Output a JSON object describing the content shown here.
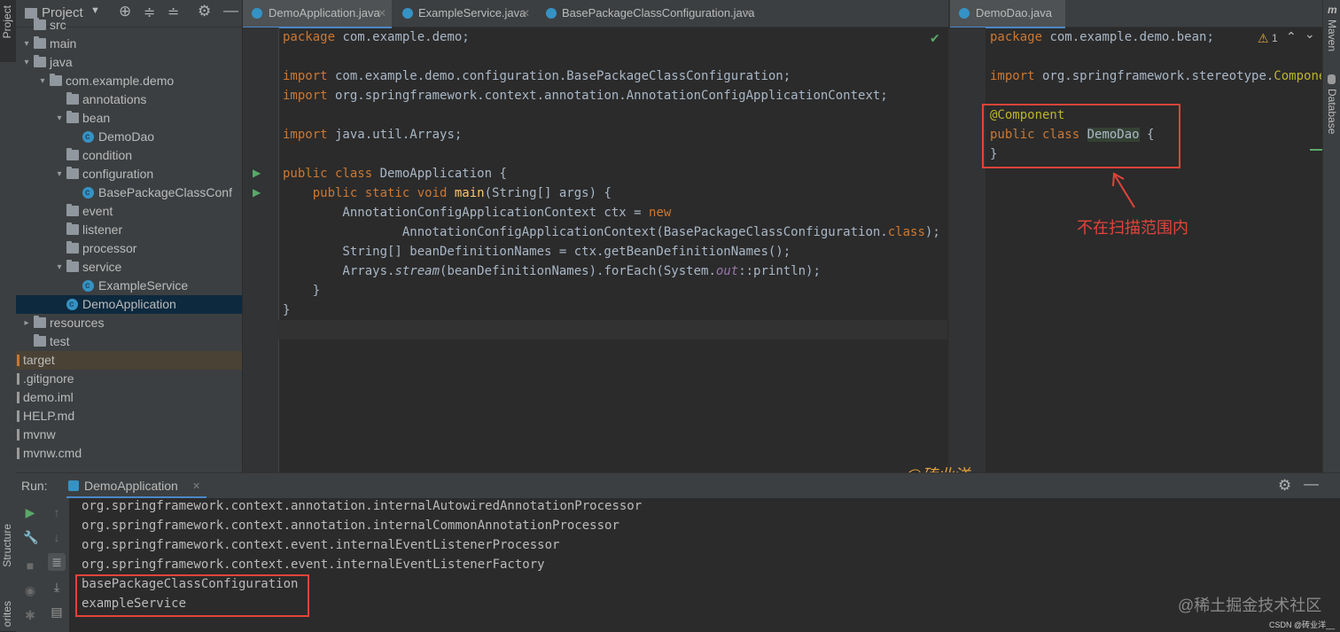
{
  "left_strip": {
    "project_label": "Project",
    "structure_label": "Structure",
    "favorites_label": "orites"
  },
  "right_strip": {
    "maven_label": "Maven",
    "database_label": "Database"
  },
  "project": {
    "title": "Project",
    "tree": [
      {
        "label": "src",
        "kind": "folder",
        "arrow": ""
      },
      {
        "label": "main",
        "kind": "folder",
        "arrow": "▾"
      },
      {
        "label": "java",
        "kind": "folder",
        "arrow": "▾"
      },
      {
        "label": "com.example.demo",
        "kind": "folder",
        "arrow": "▾"
      },
      {
        "label": "annotations",
        "kind": "folder",
        "arrow": ""
      },
      {
        "label": "bean",
        "kind": "folder",
        "arrow": "▾"
      },
      {
        "label": "DemoDao",
        "kind": "class",
        "arrow": ""
      },
      {
        "label": "condition",
        "kind": "folder",
        "arrow": ""
      },
      {
        "label": "configuration",
        "kind": "folder",
        "arrow": "▾"
      },
      {
        "label": "BasePackageClassConf",
        "kind": "class",
        "arrow": ""
      },
      {
        "label": "event",
        "kind": "folder",
        "arrow": ""
      },
      {
        "label": "listener",
        "kind": "folder",
        "arrow": ""
      },
      {
        "label": "processor",
        "kind": "folder",
        "arrow": ""
      },
      {
        "label": "service",
        "kind": "folder",
        "arrow": "▾"
      },
      {
        "label": "ExampleService",
        "kind": "class",
        "arrow": ""
      },
      {
        "label": "DemoApplication",
        "kind": "class",
        "arrow": "",
        "selected": true
      },
      {
        "label": "resources",
        "kind": "folder",
        "arrow": "▸"
      },
      {
        "label": "test",
        "kind": "folder",
        "arrow": ""
      },
      {
        "label": "target",
        "kind": "file",
        "arrow": ""
      },
      {
        "label": ".gitignore",
        "kind": "file",
        "arrow": ""
      },
      {
        "label": "demo.iml",
        "kind": "file",
        "arrow": ""
      },
      {
        "label": "HELP.md",
        "kind": "file",
        "arrow": ""
      },
      {
        "label": "mvnw",
        "kind": "file",
        "arrow": ""
      },
      {
        "label": "mvnw.cmd",
        "kind": "file",
        "arrow": ""
      }
    ]
  },
  "editor_left": {
    "tabs": [
      {
        "label": "DemoApplication.java",
        "active": true
      },
      {
        "label": "ExampleService.java",
        "active": false
      },
      {
        "label": "BasePackageClassConfiguration.java",
        "active": false
      }
    ],
    "lines": {
      "l1": [
        "package",
        " com.example.demo;"
      ],
      "l3": [
        "import",
        " com.example.demo.configuration.BasePackageClassConfiguration;"
      ],
      "l4": [
        "import",
        " org.springframework.context.annotation.AnnotationConfigApplicationContext;"
      ],
      "l6": [
        "import",
        " java.util.Arrays;"
      ],
      "l8": [
        "public class",
        " DemoApplication {"
      ],
      "l9": [
        "    ",
        "public static void",
        " ",
        "main",
        "(String[] args) {"
      ],
      "l10": [
        "        AnnotationConfigApplicationContext ctx = ",
        "new"
      ],
      "l11": [
        "                AnnotationConfigApplicationContext(BasePackageClassConfiguration.",
        "class",
        ");"
      ],
      "l12": [
        "        String[] beanDefinitionNames = ctx.getBeanDefinitionNames();"
      ],
      "l13": [
        "        Arrays.",
        "stream",
        "(beanDefinitionNames).forEach(System.",
        "out",
        "::println);"
      ],
      "l14": [
        "    }"
      ],
      "l15": [
        "}"
      ]
    }
  },
  "editor_right": {
    "tab": "DemoDao.java",
    "warning_count": "1",
    "lines": {
      "l1": [
        "package",
        " com.example.demo.bean;"
      ],
      "l3": [
        "import",
        " org.springframework.stereotype.",
        "Compone"
      ],
      "l5": [
        "@Component"
      ],
      "l6": [
        "public class",
        " ",
        "DemoDao",
        " {"
      ],
      "l7": [
        "}"
      ]
    },
    "annotation_note": "不在扫描范围内"
  },
  "watermark_author": "@砖业洋__",
  "run": {
    "label": "Run:",
    "tab": "DemoApplication",
    "output": [
      "org.springframework.context.annotation.internalAutowiredAnnotationProcessor",
      "org.springframework.context.annotation.internalCommonAnnotationProcessor",
      "org.springframework.context.event.internalEventListenerProcessor",
      "org.springframework.context.event.internalEventListenerFactory",
      "basePackageClassConfiguration",
      "exampleService"
    ]
  },
  "footer": {
    "watermark": "@稀土掘金技术社区",
    "csdn": "CSDN @砖业洋__"
  },
  "colors": {
    "accent_red": "#e2443a",
    "keyword": "#cc7832",
    "annotation": "#bbb529",
    "method": "#ffc66d"
  }
}
